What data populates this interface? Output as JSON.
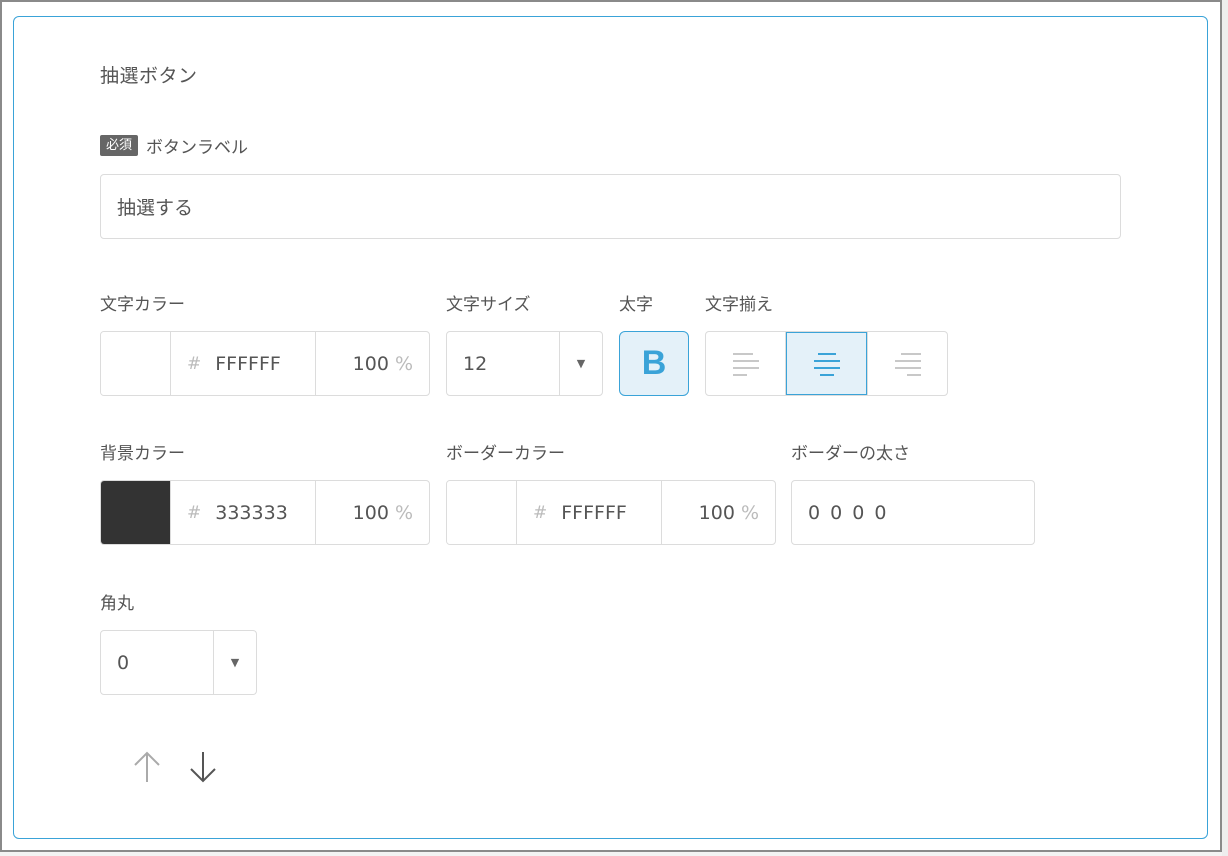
{
  "section": {
    "title": "抽選ボタン"
  },
  "button_label": {
    "required_badge": "必須",
    "label": "ボタンラベル",
    "value": "抽選する"
  },
  "text_color": {
    "label": "文字カラー",
    "swatch_color": "#FFFFFF",
    "hash": "#",
    "hex": "FFFFFF",
    "opacity": "100",
    "percent": "%"
  },
  "text_size": {
    "label": "文字サイズ",
    "value": "12"
  },
  "bold": {
    "label": "太字",
    "glyph": "B",
    "active": true
  },
  "text_align": {
    "label": "文字揃え",
    "options": [
      "left-align-icon",
      "center-align-icon",
      "right-align-icon"
    ],
    "selected": "center"
  },
  "bg_color": {
    "label": "背景カラー",
    "swatch_color": "#333333",
    "hash": "#",
    "hex": "333333",
    "opacity": "100",
    "percent": "%"
  },
  "border_color": {
    "label": "ボーダーカラー",
    "swatch_color": "#FFFFFF",
    "hash": "#",
    "hex": "FFFFFF",
    "opacity": "100",
    "percent": "%"
  },
  "border_width": {
    "label": "ボーダーの太さ",
    "value": "0 0 0 0"
  },
  "corner_radius": {
    "label": "角丸",
    "value": "0"
  },
  "order_controls": {
    "up_icon": "arrow-up-icon",
    "down_icon": "arrow-down-icon"
  },
  "colors": {
    "accent": "#3aa3d8",
    "accent_bg": "#e4f1f9",
    "border": "#dcdcdc",
    "text": "#555555"
  }
}
